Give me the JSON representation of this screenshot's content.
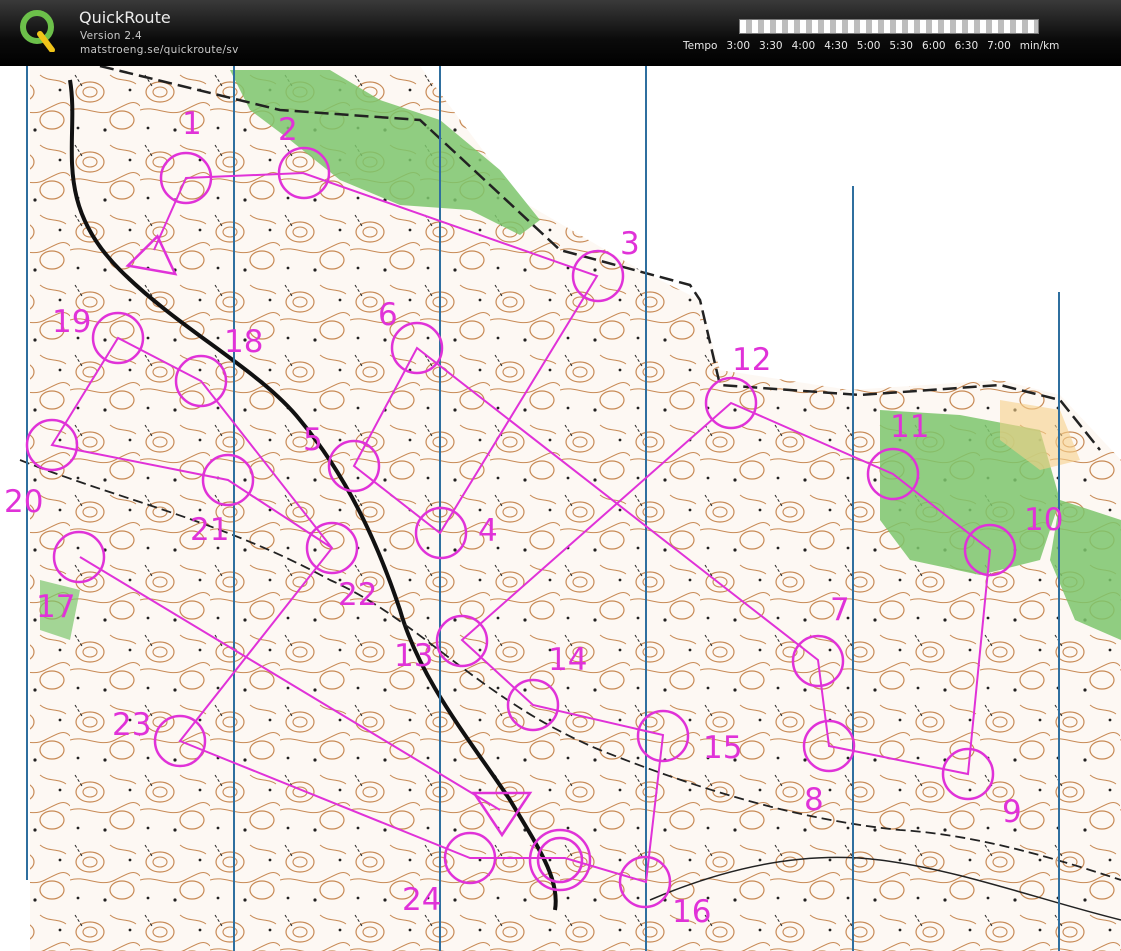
{
  "app": {
    "title": "QuickRoute",
    "version": "Version 2.4",
    "url": "matstroeng.se/quickroute/sv"
  },
  "tempo": {
    "prefix": "Tempo",
    "labels": [
      "3:00",
      "3:30",
      "4:00",
      "4:30",
      "5:00",
      "5:30",
      "6:00",
      "6:30",
      "7:00"
    ],
    "unit": "min/km"
  },
  "course": {
    "color": "#e032d8",
    "controls": [
      "1",
      "2",
      "3",
      "4",
      "5",
      "6",
      "7",
      "8",
      "9",
      "10",
      "11",
      "12",
      "13",
      "14",
      "15",
      "16",
      "17",
      "18",
      "19",
      "20",
      "21",
      "22",
      "23",
      "24"
    ]
  },
  "colors": {
    "forest_green": "#7cc66c",
    "contour_brown": "#b9773d",
    "north_lines": "#2f6f9f",
    "open_yellow": "#f7d08a"
  }
}
